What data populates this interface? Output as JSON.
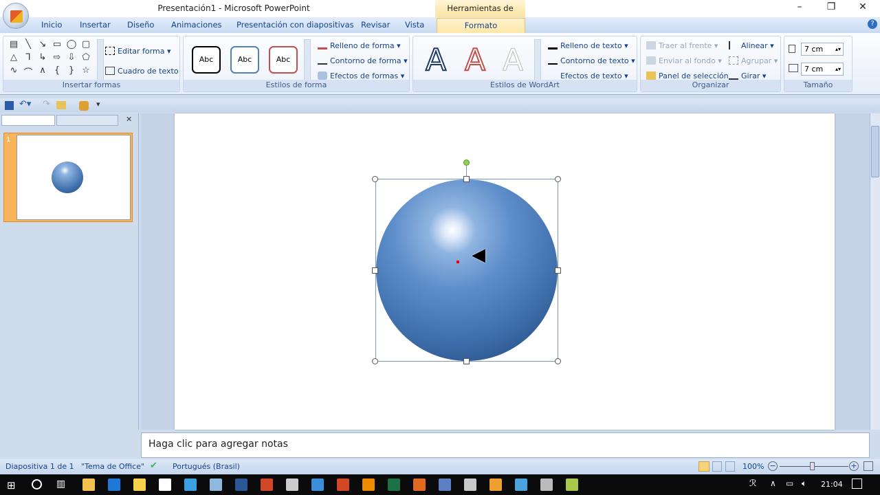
{
  "window": {
    "title": "Presentación1 - Microsoft PowerPoint",
    "context_tab": "Herramientas de dibujo",
    "minimize": "–",
    "maximize": "❐",
    "close": "✕"
  },
  "tabs": [
    "Inicio",
    "Insertar",
    "Diseño",
    "Animaciones",
    "Presentación con diapositivas",
    "Revisar",
    "Vista",
    "Formato"
  ],
  "ribbon": {
    "insertar_formas": {
      "label": "Insertar formas",
      "editar": "Editar forma",
      "cuadro": "Cuadro de texto",
      "shapes": [
        "▤",
        "╲",
        "↘",
        "▭",
        "◯",
        "▢",
        "△",
        "⅂",
        "↳",
        "⇨",
        "⇩",
        "⬠",
        "∿",
        "⌒",
        "∧",
        "{",
        "}",
        "☆"
      ]
    },
    "estilos_forma": {
      "label": "Estilos de forma",
      "samples": [
        "Abc",
        "Abc",
        "Abc"
      ],
      "sample_colors": [
        "#000000",
        "#4f81bd",
        "#c0504d"
      ],
      "relleno": "Relleno de forma",
      "contorno": "Contorno de forma",
      "efectos": "Efectos de formas"
    },
    "wordart": {
      "label": "Estilos de WordArt",
      "samples": [
        "A",
        "A",
        "A"
      ],
      "relleno": "Relleno de texto",
      "contorno": "Contorno de texto",
      "efectos": "Efectos de texto"
    },
    "organizar": {
      "label": "Organizar",
      "traer": "Traer al frente",
      "enviar": "Enviar al fondo",
      "panel": "Panel de selección",
      "alinear": "Alinear",
      "agrupar": "Agrupar",
      "girar": "Girar"
    },
    "tamano": {
      "label": "Tamaño",
      "height": "7 cm",
      "width": "7 cm"
    }
  },
  "notes": {
    "placeholder": "Haga clic para agregar notas"
  },
  "slide_pane": {
    "slide_number": "1"
  },
  "status": {
    "slide": "Diapositiva 1 de 1",
    "theme": "\"Tema de Office\"",
    "language": "Portugués (Brasil)",
    "zoom": "100%",
    "zoom_level": 100
  },
  "taskbar": {
    "time": "21:04",
    "apps": [
      {
        "name": "explorer",
        "color": "#f2c14e"
      },
      {
        "name": "edge",
        "color": "#1e78d7"
      },
      {
        "name": "store",
        "color": "#f6d34b"
      },
      {
        "name": "mail",
        "color": "#ffffff"
      },
      {
        "name": "app",
        "color": "#3aa0e0"
      },
      {
        "name": "notepad",
        "color": "#8fb8de"
      },
      {
        "name": "word",
        "color": "#2b5797"
      },
      {
        "name": "office",
        "color": "#d24726"
      },
      {
        "name": "tool",
        "color": "#cccccc"
      },
      {
        "name": "desktop",
        "color": "#3b8ed9"
      },
      {
        "name": "powerpoint",
        "color": "#d24726"
      },
      {
        "name": "vlc",
        "color": "#f08a00"
      },
      {
        "name": "excel",
        "color": "#1e7145"
      },
      {
        "name": "app2",
        "color": "#e06a20"
      },
      {
        "name": "word2",
        "color": "#5b7fc0"
      },
      {
        "name": "app3",
        "color": "#c9c9c9"
      },
      {
        "name": "app4",
        "color": "#f0a030"
      },
      {
        "name": "app5",
        "color": "#4aa3df"
      },
      {
        "name": "app6",
        "color": "#bbbbbb"
      },
      {
        "name": "app7",
        "color": "#a7c84a"
      }
    ]
  }
}
